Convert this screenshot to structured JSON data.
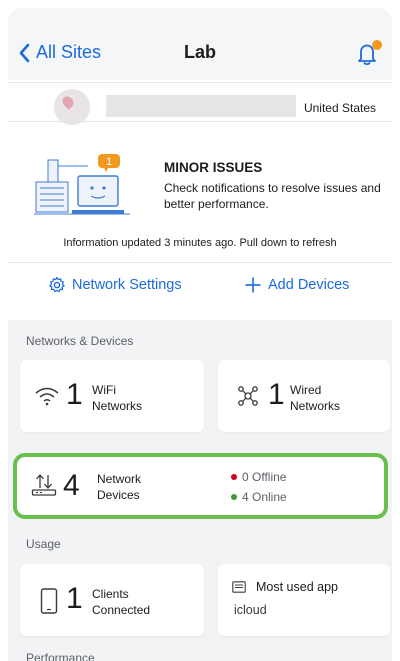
{
  "nav": {
    "back_label": "All Sites",
    "title": "Lab"
  },
  "site": {
    "country": "United States"
  },
  "issues": {
    "badge_count": "1",
    "title": "MINOR ISSUES",
    "description": "Check notifications to resolve issues and better performance."
  },
  "update_note": "Information updated 3 minutes ago. Pull down to refresh",
  "actions": {
    "network_settings": "Network Settings",
    "add_devices": "Add Devices"
  },
  "networks_devices": {
    "section_label": "Networks & Devices",
    "wifi": {
      "count": "1",
      "label_line1": "WiFi",
      "label_line2": "Networks"
    },
    "wired": {
      "count": "1",
      "label_line1": "Wired",
      "label_line2": "Networks"
    },
    "network_devices": {
      "count": "4",
      "label_line1": "Network",
      "label_line2": "Devices",
      "offline": "0 Offline",
      "online": "4 Online"
    }
  },
  "usage": {
    "section_label": "Usage",
    "clients": {
      "count": "1",
      "label_line1": "Clients",
      "label_line2": "Connected"
    },
    "most_used": {
      "title": "Most used app",
      "value": "icloud"
    }
  },
  "performance": {
    "section_label": "Performance"
  },
  "colors": {
    "accent": "#1d6ae0",
    "highlight": "#6bbf4e",
    "offline": "#d0021b",
    "online": "#3f9b2f",
    "badge": "#f29a1f"
  }
}
